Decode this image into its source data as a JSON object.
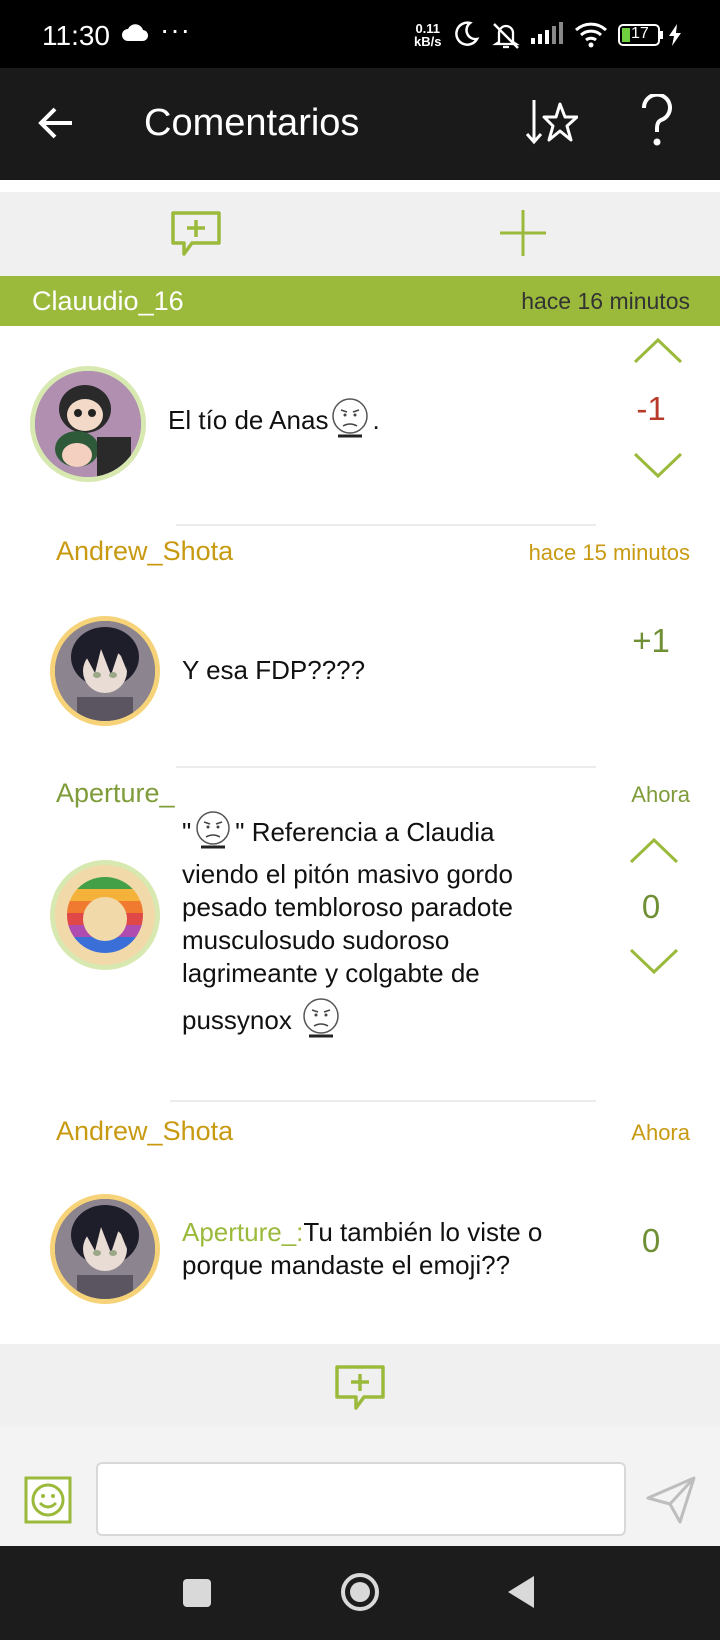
{
  "status_bar": {
    "time": "11:30",
    "dots": "···",
    "net_speed_value": "0.11",
    "net_speed_unit": "kB/s",
    "battery": "17"
  },
  "app_bar": {
    "title": "Comentarios"
  },
  "thread": {
    "author": "Clauudio_16",
    "time": "hace 16 minutos"
  },
  "comments": [
    {
      "text": "El tío de Anas",
      "after_emoji": ".",
      "score": "-1"
    },
    {
      "author": "Andrew_Shota",
      "time": "hace 15 minutos",
      "text": "Y esa FDP????",
      "score": "+1"
    },
    {
      "author": "Aperture_",
      "time": "Ahora",
      "quote_open": "\"",
      "quote_close": "\" Referencia a Claudia",
      "line2": "viendo el pitón masivo gordo",
      "line3": "pesado tembloroso paradote",
      "line4": "musculosudo sudoroso",
      "line5": "lagrimeante y colgabte de",
      "line6": "pussynox",
      "score": "0"
    },
    {
      "author": "Andrew_Shota",
      "time": "Ahora",
      "mention": "Aperture_:",
      "text": "Tu también lo viste o",
      "text2": "porque mandaste el emoji??",
      "score": "0"
    }
  ],
  "icons": {
    "back": "arrow-left-icon",
    "sort": "sort-star-icon",
    "help": "question-icon",
    "add_comment": "comment-plus-icon",
    "add": "plus-icon",
    "emoji": "smiley-icon",
    "send": "send-icon"
  },
  "colors": {
    "accent_green": "#9bba3c",
    "author_gold": "#c89a12",
    "author_green": "#7f9c3a",
    "negative": "#b83a2a",
    "positive": "#6f8f34"
  }
}
